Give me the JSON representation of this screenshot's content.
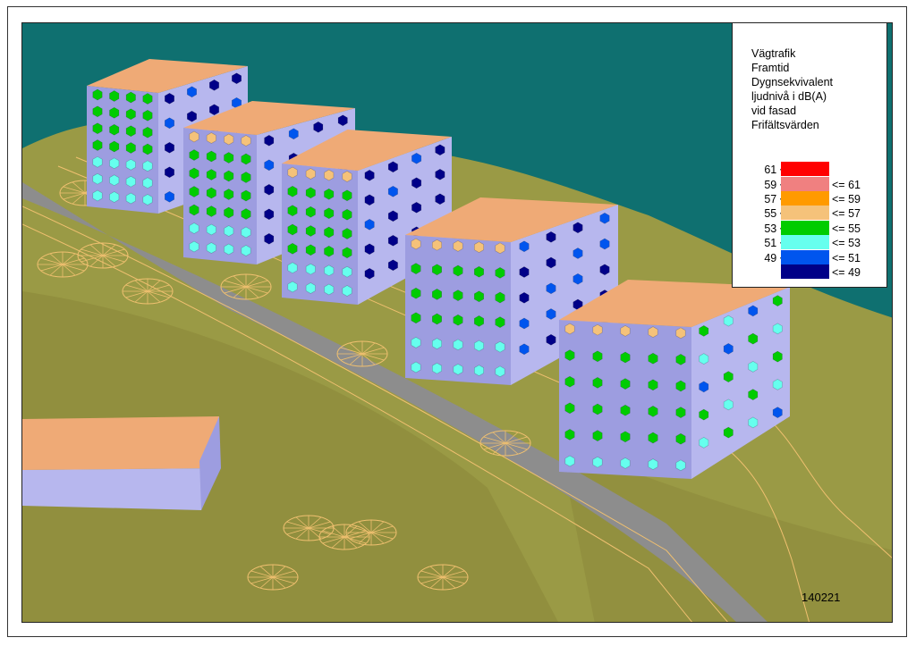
{
  "legend": {
    "title_lines": [
      "Vägtrafik",
      "Framtid",
      "Dygnsekvivalent",
      "ljudnivå i dB(A)",
      "vid fasad",
      "Frifältsvärden"
    ],
    "classes": [
      {
        "lower": "61 <",
        "upper": "",
        "color": "#ff0000"
      },
      {
        "lower": "59 <",
        "upper": "<= 61",
        "color": "#f08080"
      },
      {
        "lower": "57 <",
        "upper": "<= 59",
        "color": "#ff9a00"
      },
      {
        "lower": "55 <",
        "upper": "<= 57",
        "color": "#f5c27a"
      },
      {
        "lower": "53 <",
        "upper": "<= 55",
        "color": "#00cc00"
      },
      {
        "lower": "51 <",
        "upper": "<= 53",
        "color": "#66ffee"
      },
      {
        "lower": "49 <",
        "upper": "<= 51",
        "color": "#0055ee"
      },
      {
        "lower": "",
        "upper": "<= 49",
        "color": "#000088"
      }
    ]
  },
  "stamp": "140221",
  "colors": {
    "sky": "#0f7070",
    "terrain": "#9a9a45",
    "terrain_dark": "#807a32",
    "road": "#8d8d8d",
    "roof": "#efaa76",
    "facade": "#b7b7ee",
    "facade_dark": "#9d9de0",
    "survey_lines": "#f0c070"
  }
}
